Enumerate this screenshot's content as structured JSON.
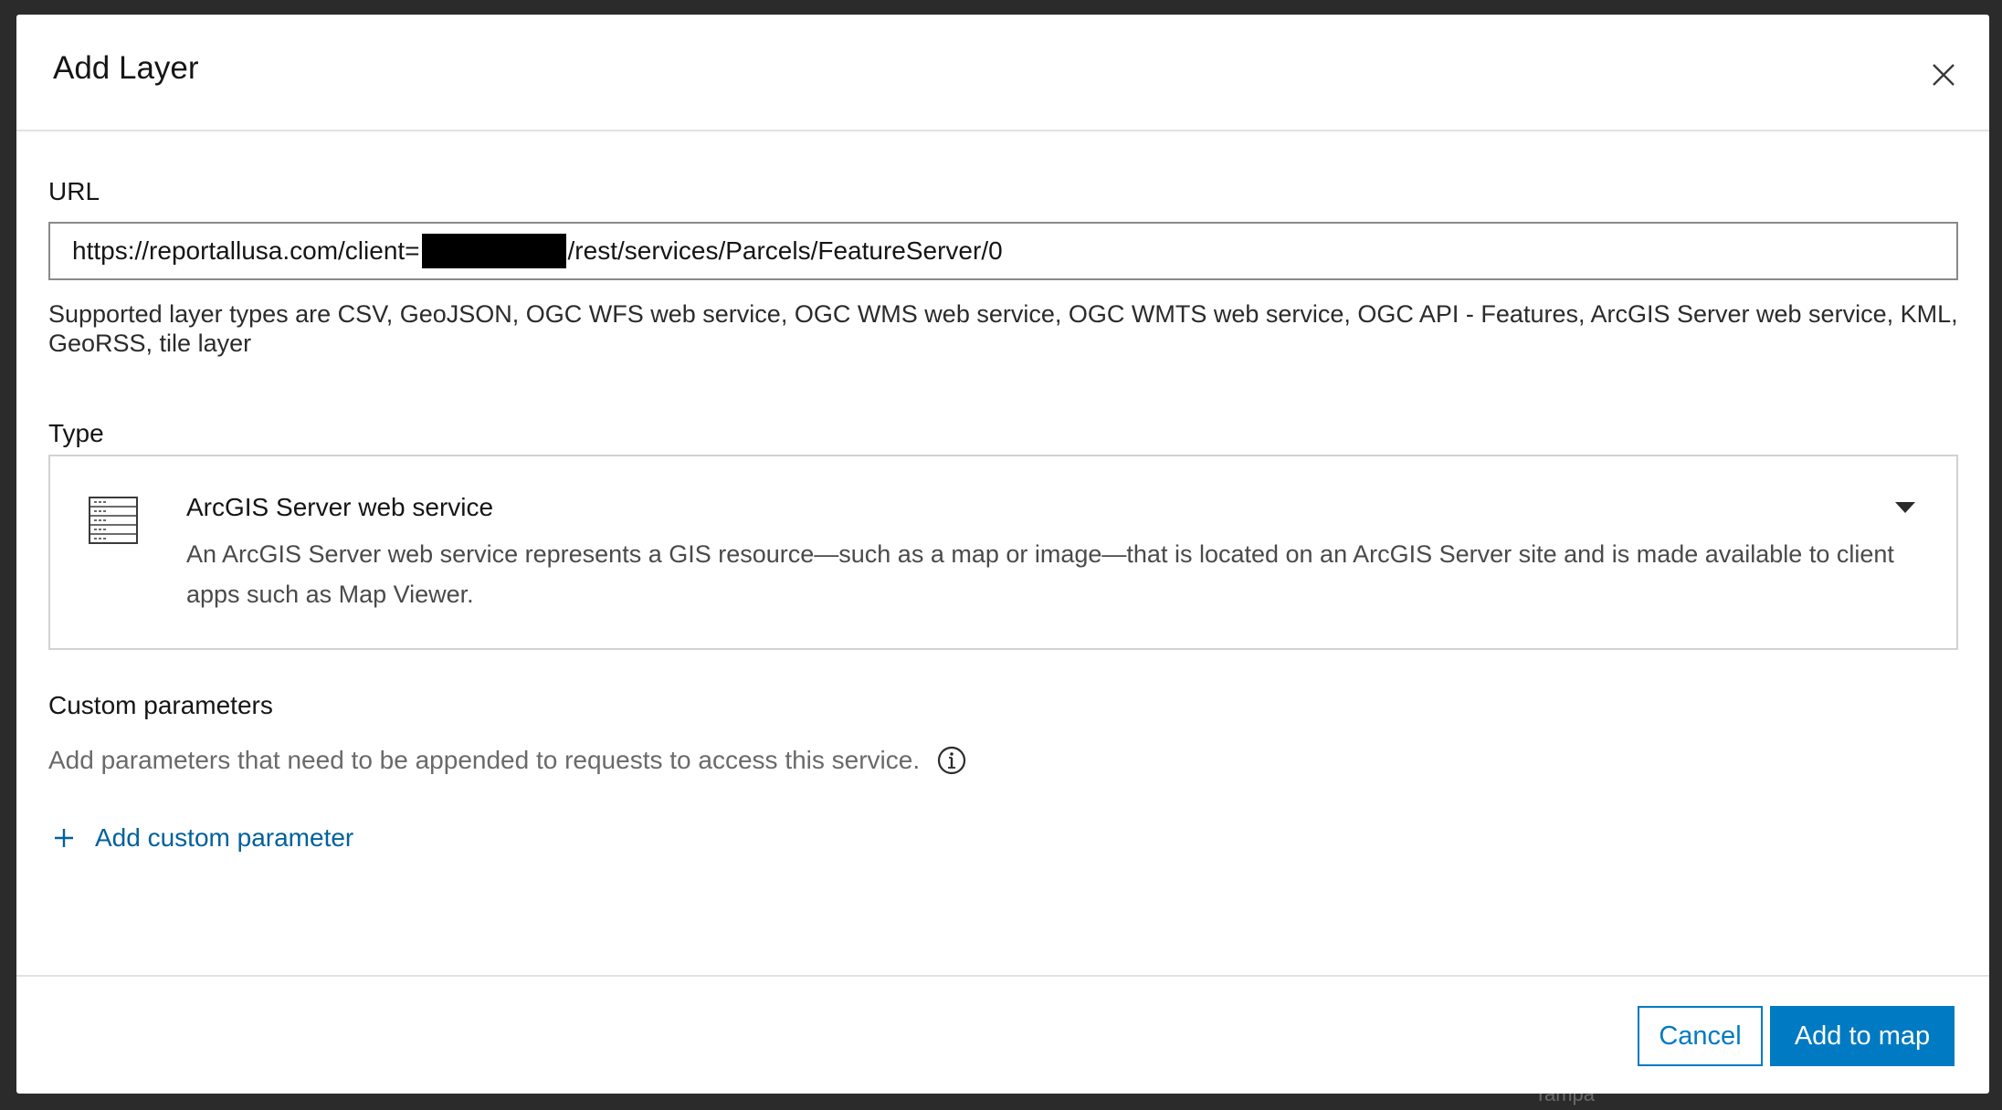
{
  "modal": {
    "title": "Add Layer"
  },
  "url_field": {
    "label": "URL",
    "value_prefix": "https://reportallusa.com/client=",
    "value_suffix": "/rest/services/Parcels/FeatureServer/0"
  },
  "supported_hint": "Supported layer types are CSV, GeoJSON, OGC WFS web service, OGC WMS web service, OGC WMTS web service, OGC API - Features, ArcGIS Server web service, KML, GeoRSS, tile layer",
  "type_field": {
    "label": "Type",
    "selected_title": "ArcGIS Server web service",
    "selected_description": "An ArcGIS Server web service represents a GIS resource—such as a map or image—that is located on an ArcGIS Server site and is made available to client apps such as Map Viewer.",
    "icon": "service-list-icon"
  },
  "custom_params": {
    "label": "Custom parameters",
    "description": "Add parameters that need to be appended to requests to access this service.",
    "add_label": "Add custom parameter"
  },
  "footer": {
    "cancel_label": "Cancel",
    "add_label": "Add to map"
  },
  "background": {
    "label_bottom": "Tampa"
  },
  "colors": {
    "accent": "#007ac2",
    "link": "#00619b"
  }
}
